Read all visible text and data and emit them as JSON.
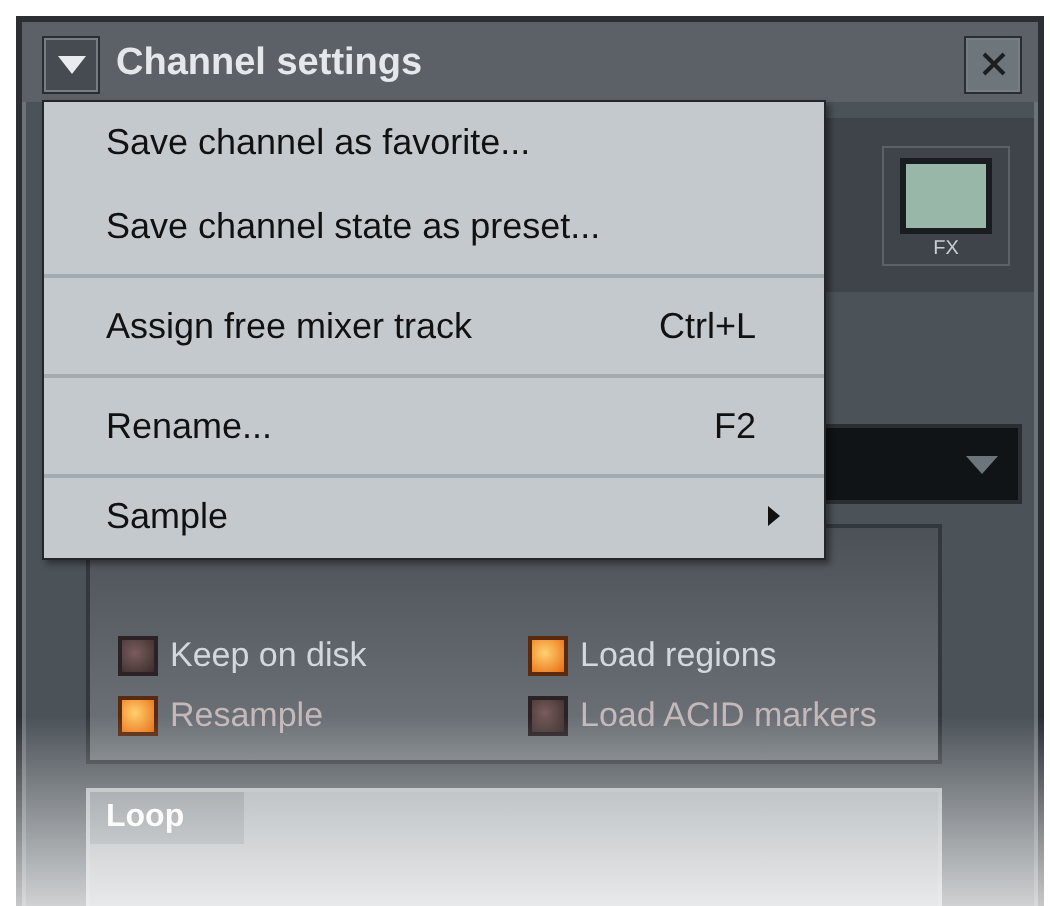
{
  "window": {
    "title": "Channel settings"
  },
  "context_menu": {
    "items": [
      {
        "label": "Save channel as favorite...",
        "separator_after": false
      },
      {
        "label": "Save channel state as preset...",
        "separator_after": true
      },
      {
        "label": "Assign free mixer track",
        "shortcut": "Ctrl+L",
        "separator_after": true
      },
      {
        "label": "Rename...",
        "shortcut": "F2",
        "separator_after": true
      },
      {
        "label": "Sample",
        "has_submenu": true,
        "separator_after": false
      }
    ]
  },
  "fx_display": {
    "label": "FX"
  },
  "sample_options": [
    {
      "label": "Keep on disk",
      "checked": false
    },
    {
      "label": "Load regions",
      "checked": true
    },
    {
      "label": "Resample",
      "checked": true
    },
    {
      "label": "Load ACID markers",
      "checked": false
    }
  ],
  "loop_group": {
    "title": "Loop"
  }
}
